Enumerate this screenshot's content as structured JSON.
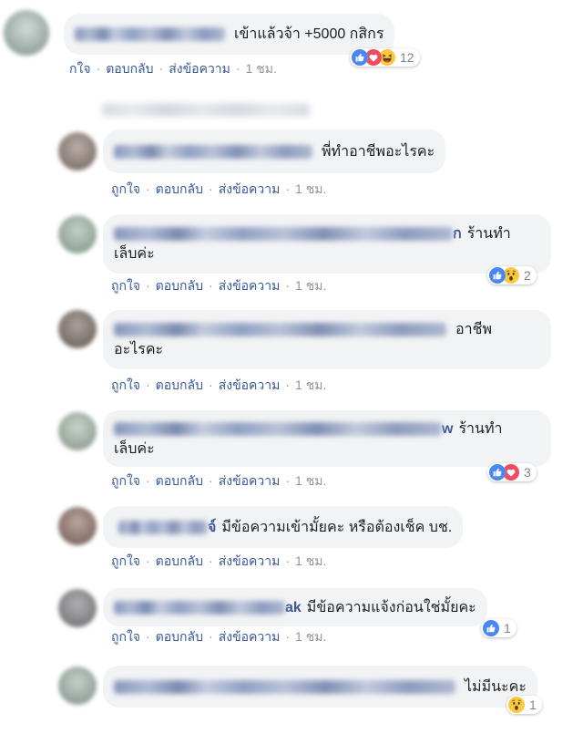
{
  "colors": {
    "bubble": "#f2f3f5",
    "link": "#385898",
    "meta": "#90949c",
    "text": "#1c1e21"
  },
  "labels": {
    "like": "ถูกใจ",
    "reply": "ตอบกลับ",
    "message": "ส่งข้อความ",
    "separator": "·"
  },
  "top_comment": {
    "text": "เข้าแล้วจ้า +5000 กสิกร",
    "like_label": "กใจ",
    "time": "1 ชม.",
    "reactions": {
      "types": [
        "like-icon",
        "love-icon",
        "haha-icon"
      ],
      "count": "12"
    }
  },
  "replies": [
    {
      "text": "พี่ทำอาชีพอะไรคะ",
      "time": "1 ชม."
    },
    {
      "name_tail": "ก",
      "line1": "ร้านทำ",
      "line2": "เล็บค่ะ",
      "time": "1 ชม.",
      "reactions": {
        "types": [
          "like-icon",
          "wow-icon"
        ],
        "count": "2"
      }
    },
    {
      "line1": "อาชีพ",
      "line2": "อะไรคะ",
      "time": "1 ชม."
    },
    {
      "name_tail": "w",
      "line1": "ร้านทำ",
      "line2": "เล็บค่ะ",
      "time": "1 ชม.",
      "reactions": {
        "types": [
          "like-icon",
          "love-icon"
        ],
        "count": "3"
      }
    },
    {
      "name_tail": "จ์",
      "text": "มีข้อความเข้ามั้ยคะ หรือต้องเช็ค บช.",
      "time": "1 ชม."
    },
    {
      "name_tail": "ak",
      "text": "มีข้อความแจ้งก่อนใช่มั้ยคะ",
      "time": "1 ชม.",
      "reactions": {
        "types": [
          "like-icon"
        ],
        "count": "1"
      }
    },
    {
      "text": "ไม่มีนะคะ",
      "reactions": {
        "types": [
          "wow-icon"
        ],
        "count": "1"
      }
    }
  ]
}
